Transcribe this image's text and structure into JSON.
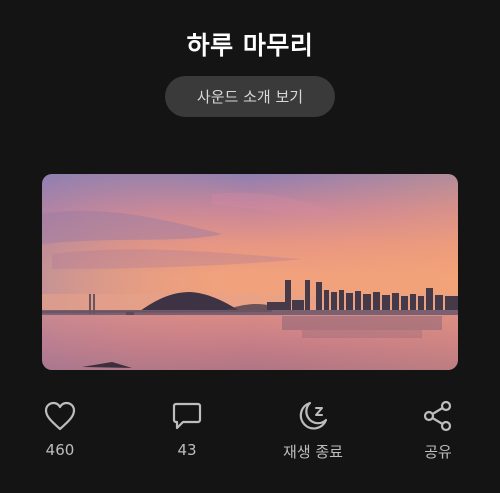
{
  "header": {
    "title": "하루 마무리",
    "sound_intro_label": "사운드 소개 보기"
  },
  "artwork": {
    "description_icon": "sunset-cityscape-image"
  },
  "actions": {
    "like": {
      "icon": "heart-icon",
      "count": "460"
    },
    "comment": {
      "icon": "comment-icon",
      "count": "43"
    },
    "sleep_timer": {
      "icon": "moon-sleep-icon",
      "label": "재생 종료"
    },
    "share": {
      "icon": "share-icon",
      "label": "공유"
    }
  },
  "colors": {
    "background": "#141414",
    "button_bg": "#3a3a3a",
    "icon": "#bdbdbd"
  }
}
